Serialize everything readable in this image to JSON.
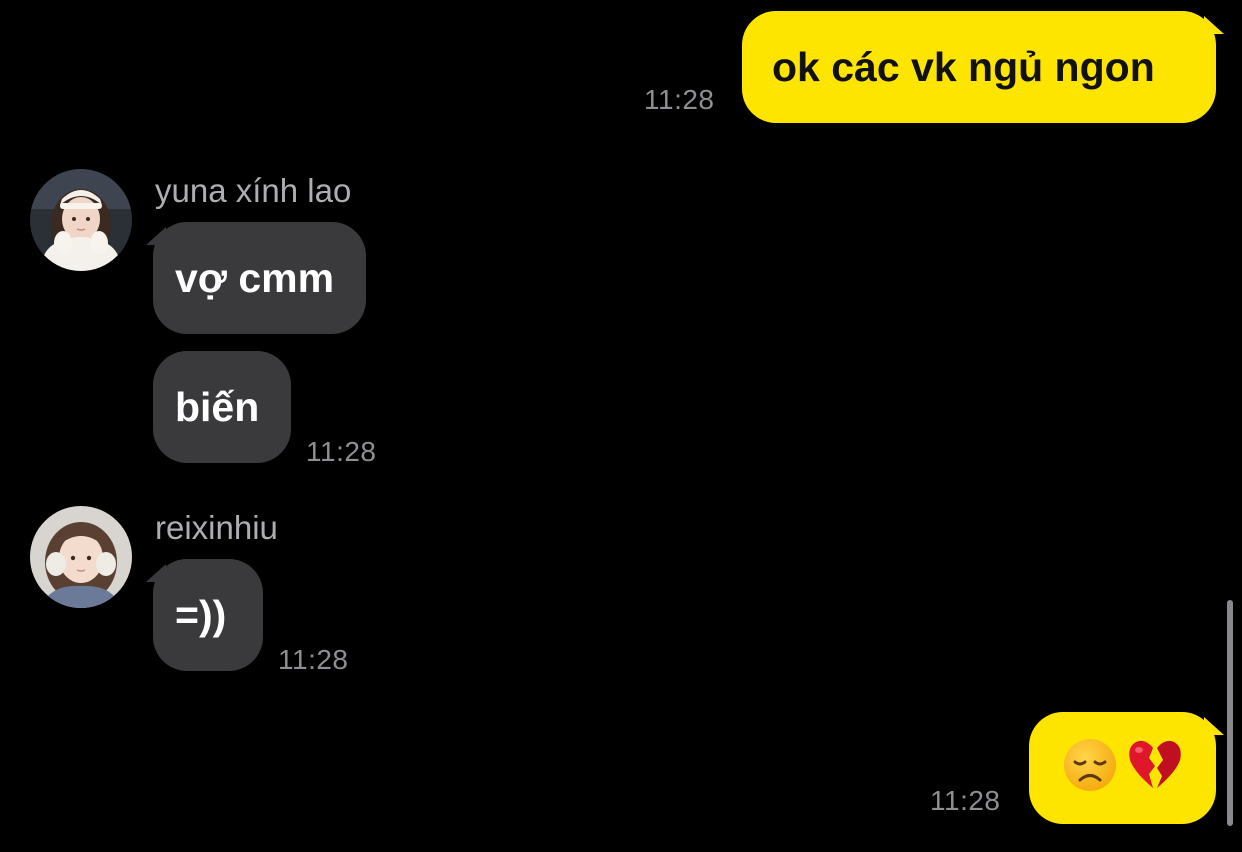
{
  "chat": {
    "messages": [
      {
        "id": "m1",
        "direction": "outgoing",
        "text": "ok các vk ngủ ngon",
        "time": "11:28"
      },
      {
        "id": "m2",
        "direction": "incoming",
        "sender": "yuna xính lao",
        "text": "vợ cmm"
      },
      {
        "id": "m3",
        "direction": "incoming",
        "text": "biến",
        "time": "11:28"
      },
      {
        "id": "m4",
        "direction": "incoming",
        "sender": "reixinhiu",
        "text": "=))",
        "time": "11:28"
      },
      {
        "id": "m5",
        "direction": "outgoing",
        "emoji": [
          "disappointed-face-emoji",
          "broken-heart-emoji"
        ],
        "time": "11:28"
      }
    ]
  },
  "colors": {
    "background": "#000000",
    "outgoing_bubble": "#FEE500",
    "incoming_bubble": "#3A3A3C",
    "timestamp": "#8E8E93",
    "sender_name": "#AEAEB2"
  }
}
